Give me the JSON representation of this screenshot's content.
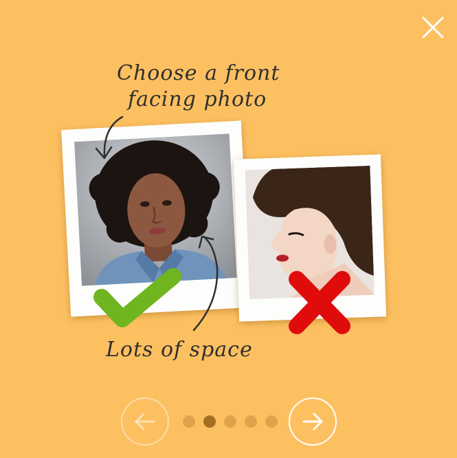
{
  "colors": {
    "background": "#fdc061",
    "check": "#6fb51f",
    "cross": "#e00c0c",
    "dot_inactive": "#e2a24b",
    "dot_active": "#a46f21"
  },
  "header": {
    "close_icon": "close-icon"
  },
  "captions": {
    "top_line1": "Choose a front",
    "top_line2": "facing photo",
    "bottom": "Lots of space"
  },
  "examples": [
    {
      "kind": "good",
      "marker_icon": "checkmark-icon"
    },
    {
      "kind": "bad",
      "marker_icon": "cross-icon"
    }
  ],
  "pagination": {
    "total": 5,
    "current": 2,
    "prev_icon": "arrow-left-icon",
    "next_icon": "arrow-right-icon",
    "prev_enabled": false,
    "next_enabled": true
  }
}
